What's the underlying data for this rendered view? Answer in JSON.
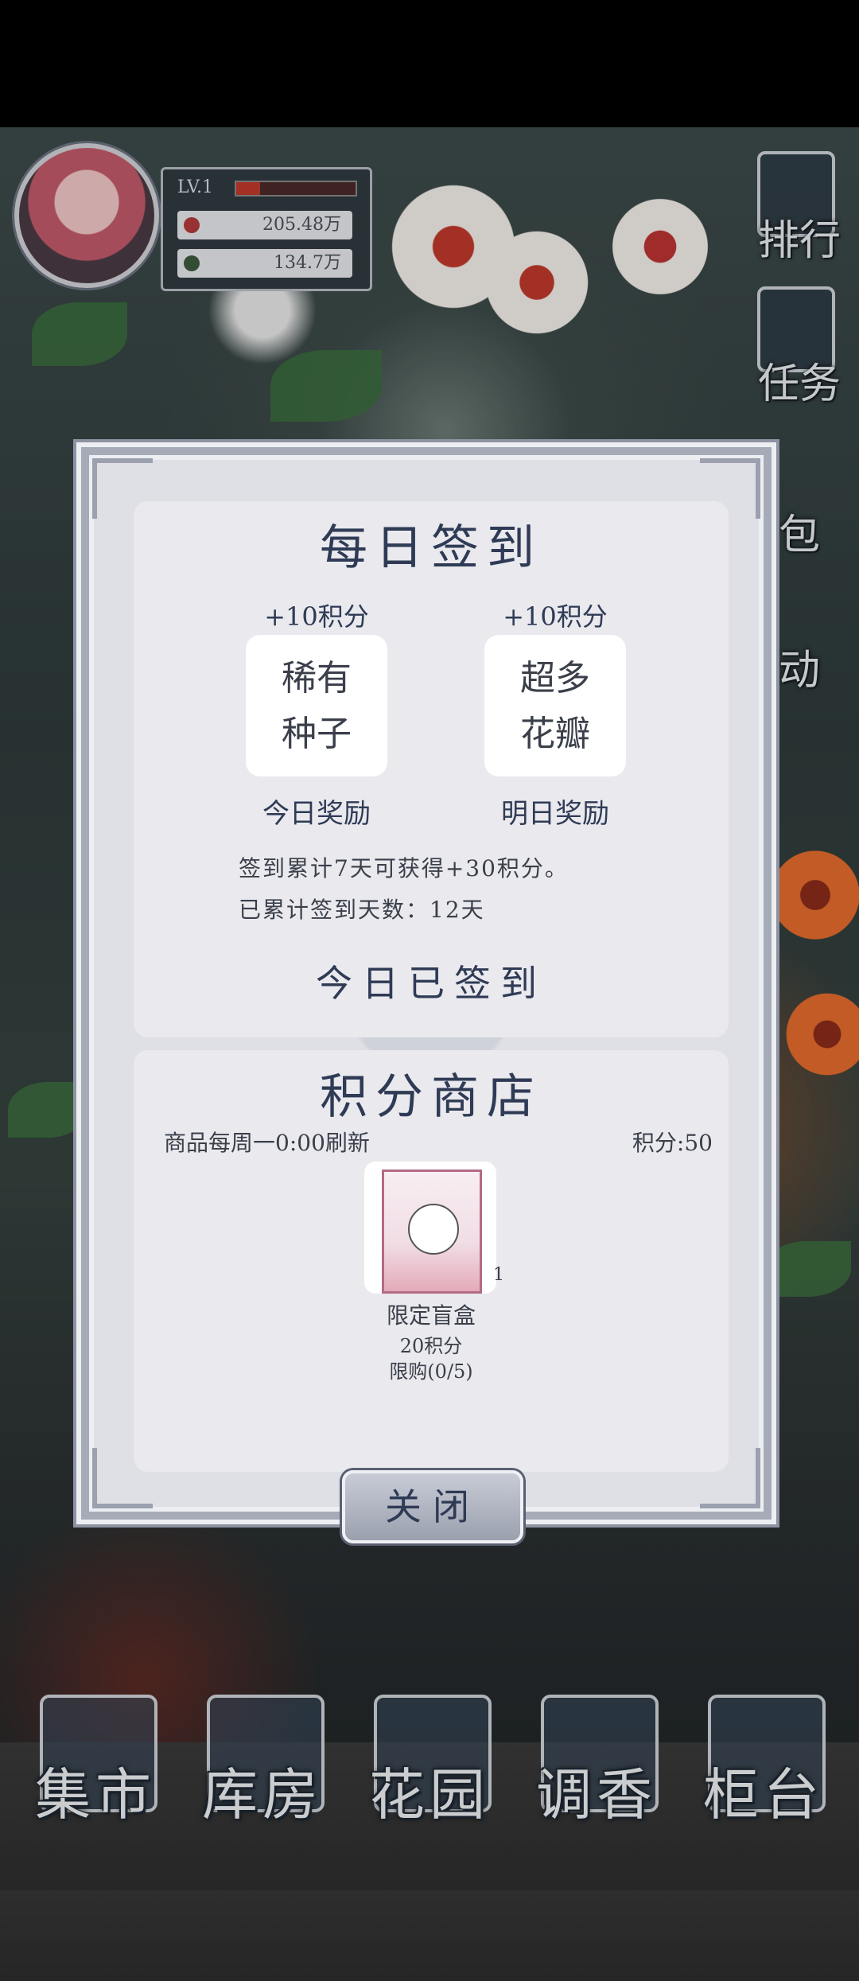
{
  "profile": {
    "level": "LV.1",
    "stat1": "205.48万",
    "stat2": "134.7万"
  },
  "side_menu": {
    "ranking": "排行",
    "tasks": "任务",
    "bag": "包",
    "activity": "动"
  },
  "daily_checkin": {
    "title": "每日签到",
    "today": {
      "points": "+10积分",
      "reward_line1": "稀有",
      "reward_line2": "种子",
      "label": "今日奖励"
    },
    "tomorrow": {
      "points": "+10积分",
      "reward_line1": "超多",
      "reward_line2": "花瓣",
      "label": "明日奖励"
    },
    "bonus_note": "签到累计7天可获得+30积分。",
    "streak_note": "已累计签到天数：12天",
    "status": "今日已签到"
  },
  "points_shop": {
    "title": "积分商店",
    "refresh_note": "商品每周一0:00刷新",
    "points_label": "积分:50",
    "item": {
      "name": "限定盲盒",
      "price": "20积分",
      "limit": "限购(0/5)",
      "quantity": "1"
    }
  },
  "close_button": "关闭",
  "bottom_nav": [
    "集市",
    "库房",
    "花园",
    "调香",
    "柜台"
  ]
}
